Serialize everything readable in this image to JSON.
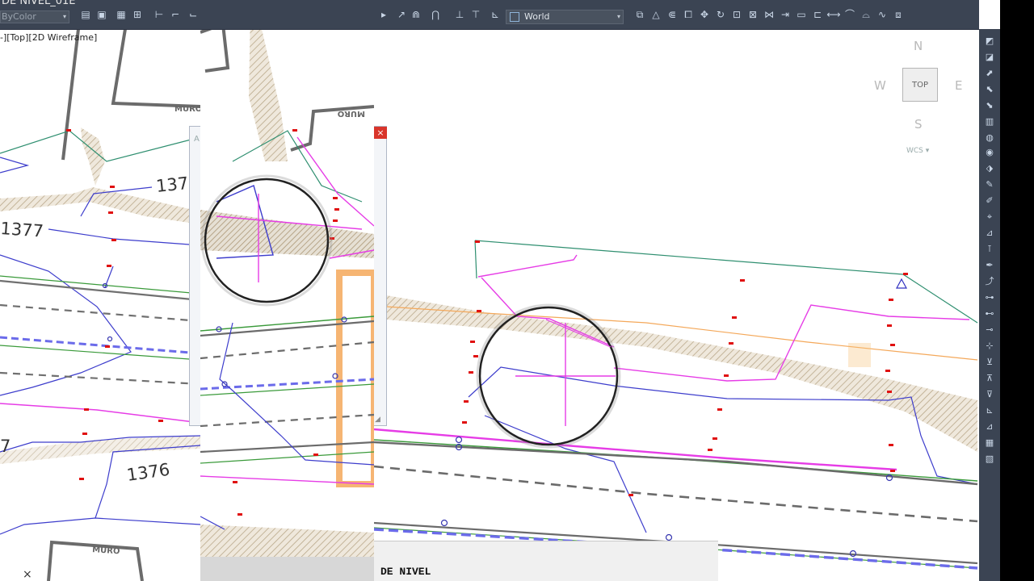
{
  "app": {
    "title_fragment": "DE NIVEL_01E",
    "color_property": "ByColor",
    "ucs_name": "World",
    "viewport_label": "-][Top][2D Wireframe]"
  },
  "viewcube": {
    "north": "N",
    "south": "S",
    "east": "E",
    "west": "W",
    "face": "TOP",
    "ucs_menu": "WCS ▾"
  },
  "drawing": {
    "contour_labels": {
      "c1376": "1376",
      "c1377": "1377",
      "c1377_partial": "137",
      "left_partial": "7"
    },
    "wall_label": "MURO",
    "wall_label_mirrored": "MURO"
  },
  "command_line": {
    "text": "DE NIVEL"
  },
  "dialog": {
    "close_glyph": "×",
    "caption_fragment": "A"
  },
  "icons": {
    "command_close": "×",
    "dropdown": "▾"
  },
  "colors": {
    "toolbar": "#3b4453",
    "contour_blue": "#3d3dcc",
    "pline_magenta": "#e63ce6",
    "line_green": "#3a9a3a",
    "line_teal": "#2f8f70",
    "hatch": "#c8b89a",
    "orange": "#f4a85a",
    "point_red": "#e01010"
  }
}
